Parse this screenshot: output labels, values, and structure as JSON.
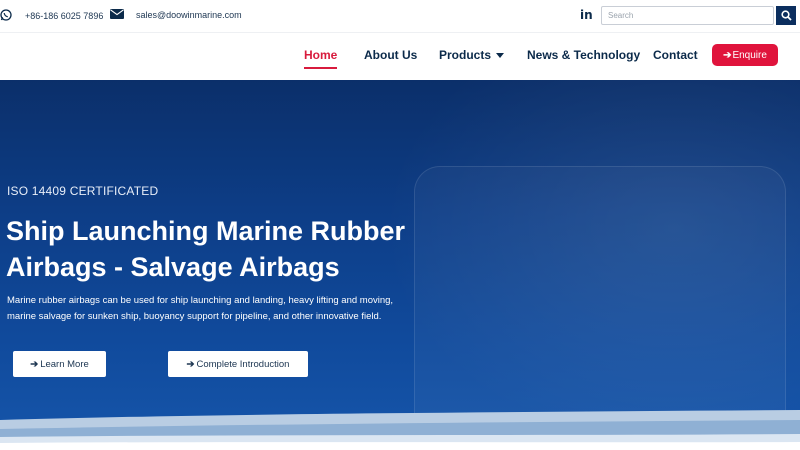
{
  "topbar": {
    "phone": "+86-186 6025 7896",
    "email": "sales@doowinmarine.com",
    "social_icon": "in",
    "search_placeholder": "Search"
  },
  "nav": {
    "items": [
      {
        "label": "Home",
        "active": true
      },
      {
        "label": "About Us"
      },
      {
        "label": "Products",
        "has_dropdown": true
      },
      {
        "label": "News & Technology"
      },
      {
        "label": "Contact"
      }
    ],
    "enquire_label": "Enquire"
  },
  "hero": {
    "eyebrow": "ISO 14409 CERTIFICATED",
    "headline": "Ship Launching Marine Rubber Airbags - Salvage Airbags",
    "description": "Marine rubber airbags can be used for ship launching and landing, heavy lifting and moving, marine salvage for sunken ship, buoyancy support for pipeline, and other innovative field.",
    "buttons": [
      "Learn More",
      "Complete Introduction"
    ]
  },
  "colors": {
    "accent": "#e0143c",
    "navy": "#0b2a4a",
    "hero_blue": "#0d3d86"
  },
  "icons": [
    "whatsapp-icon",
    "mail-icon",
    "linkedin-icon",
    "search-icon",
    "arrow-right-icon",
    "caret-down-icon"
  ]
}
